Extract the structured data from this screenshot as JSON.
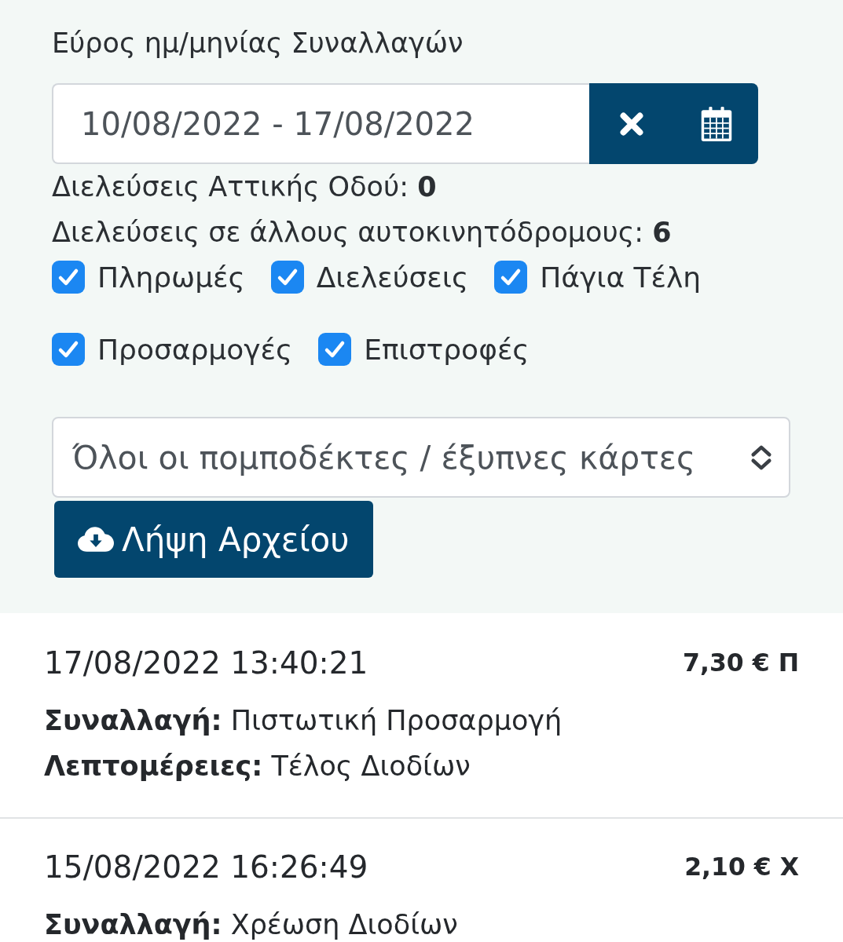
{
  "filter": {
    "date_range": {
      "label": "Εύρος ημ/μηνίας Συναλλαγών",
      "value": "10/08/2022 - 17/08/2022"
    },
    "counts": [
      "Διελεύσεις Αττικής Οδού: **0**",
      "Διελεύσεις σε άλλους αυτοκινητόδρομους: **6**"
    ],
    "checkboxes": [
      {
        "label": "Πληρωμές",
        "checked": true
      },
      {
        "label": "Διελεύσεις",
        "checked": true
      },
      {
        "label": "Πάγια Τέλη",
        "checked": true
      },
      {
        "label": "Προσαρμογές",
        "checked": true
      },
      {
        "label": "Επιστροφές",
        "checked": true
      }
    ],
    "select": {
      "value": "Όλοι οι πομποδέκτες / έξυπνες κάρτες"
    },
    "download_button": {
      "label": "Λήψη Αρχείου"
    }
  },
  "transactions": [
    {
      "datetime": "17/08/2022 13:40:21",
      "amount": "7,30 € Π",
      "fields": [
        "**Συναλλαγή:** Πιστωτική Προσαρμογή",
        "**Λεπτομέρειες:** Τέλος Διοδίων"
      ]
    },
    {
      "datetime": "15/08/2022 16:26:49",
      "amount": "2,10 € Χ",
      "fields": [
        "**Συναλλαγή:** Χρέωση Διοδίων"
      ]
    }
  ]
}
